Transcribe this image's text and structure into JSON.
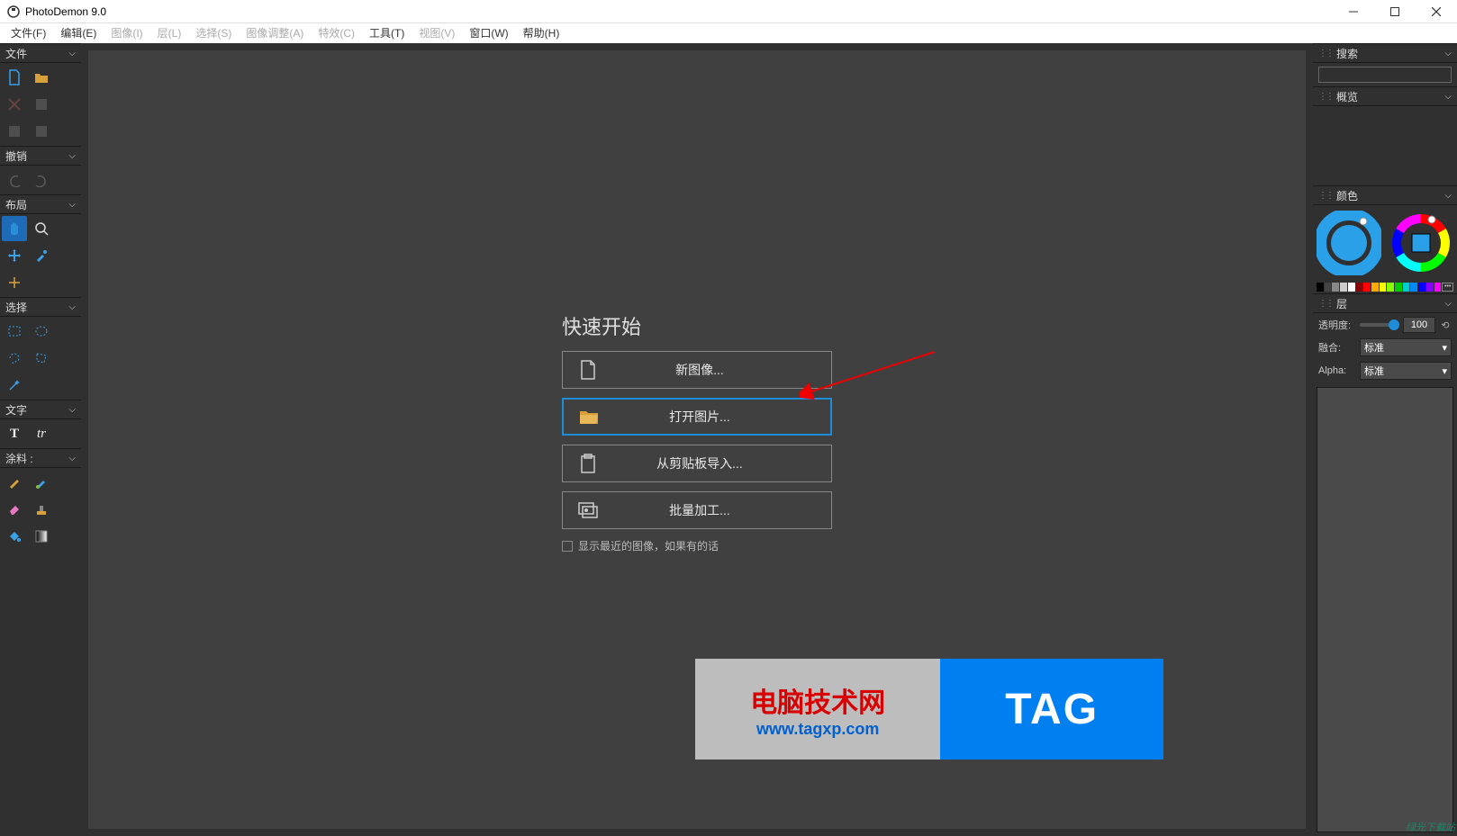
{
  "app": {
    "title": "PhotoDemon 9.0"
  },
  "menu": {
    "file": "文件(F)",
    "edit": "编辑(E)",
    "image": "图像(I)",
    "layer": "层(L)",
    "select": "选择(S)",
    "adjust": "图像调整(A)",
    "effect": "特效(C)",
    "tool": "工具(T)",
    "view": "视图(V)",
    "window": "窗口(W)",
    "help": "帮助(H)"
  },
  "left_sections": {
    "file": "文件",
    "undo": "撤销",
    "layout": "布局",
    "select": "选择",
    "text": "文字",
    "paint": "涂料 :"
  },
  "quickstart": {
    "title": "快速开始",
    "new_image": "新图像...",
    "open_image": "打开图片...",
    "from_clipboard": "从剪贴板导入...",
    "batch": "批量加工...",
    "show_recent": "显示最近的图像，如果有的话"
  },
  "right_sections": {
    "search": "搜索",
    "preview": "概览",
    "color": "颜色",
    "layer": "层"
  },
  "layer_panel": {
    "opacity_label": "透明度:",
    "opacity_value": "100",
    "blend_label": "融合:",
    "blend_value": "标准",
    "alpha_label": "Alpha:",
    "alpha_value": "标准"
  },
  "watermark": {
    "line1": "电脑技术网",
    "line2": "www.tagxp.com",
    "tag": "TAG"
  },
  "swatches": [
    "#000",
    "#444",
    "#888",
    "#ccc",
    "#fff",
    "#800",
    "#f00",
    "#fa0",
    "#ff0",
    "#8f0",
    "#0c0",
    "#0cc",
    "#08f",
    "#00f",
    "#80f",
    "#f0f"
  ]
}
